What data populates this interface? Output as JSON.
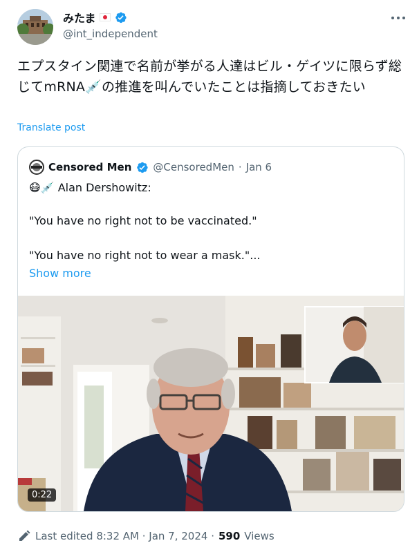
{
  "author": {
    "display_name": "みたま",
    "handle": "@int_independent",
    "flag_icon": "japan-flag-icon",
    "verified_icon": "verified-badge-icon",
    "verified_color": "#1d9bf0"
  },
  "tweet": {
    "text": "エプスタイン関連で名前が挙がる人達はビル・ゲイツに限らず総じてmRNA💉の推進を叫んでいたことは指摘しておきたい",
    "translate_label": "Translate post"
  },
  "quote": {
    "author_name": "Censored Men",
    "author_handle": "@CensoredMen",
    "separator": "·",
    "date": "Jan 6",
    "line1": "😷💉 Alan Dershowitz:",
    "line2": "\"You have no right not to be vaccinated.\"",
    "line3": "\"You have no right not to wear a mask.\"...",
    "show_more_label": "Show more",
    "video_timestamp": "0:22"
  },
  "footer": {
    "edited_label": "Last edited 8:32 AM · Jan 7, 2024 ·",
    "views_count": "590",
    "views_label": "Views"
  },
  "colors": {
    "link": "#1d9bf0",
    "secondary_text": "#536471",
    "primary_text": "#0f1419",
    "border": "#cfd9de"
  }
}
